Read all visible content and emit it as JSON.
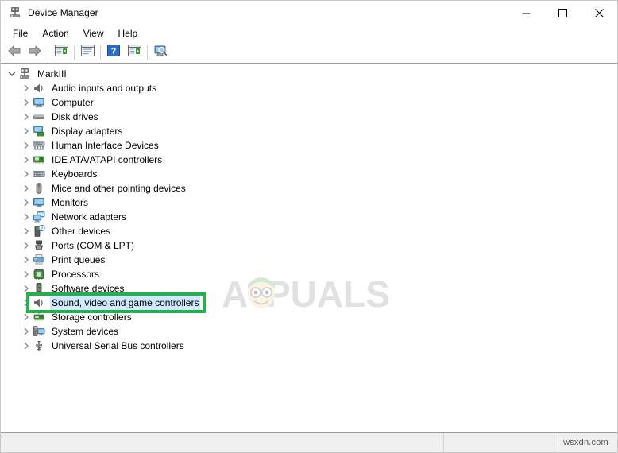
{
  "window": {
    "title": "Device Manager",
    "title_icon": "device-manager-icon",
    "controls": [
      {
        "name": "minimize-button",
        "glyph": "minimize"
      },
      {
        "name": "maximize-button",
        "glyph": "maximize"
      },
      {
        "name": "close-button",
        "glyph": "close"
      }
    ]
  },
  "menubar": {
    "items": [
      {
        "label": "File"
      },
      {
        "label": "Action"
      },
      {
        "label": "View"
      },
      {
        "label": "Help"
      }
    ]
  },
  "toolbar": {
    "buttons": [
      {
        "name": "back-button",
        "icon": "back-arrow-icon"
      },
      {
        "name": "forward-button",
        "icon": "forward-arrow-icon"
      },
      {
        "name": "show-hide-console-tree-button",
        "icon": "console-tree-icon"
      },
      {
        "name": "properties-button",
        "icon": "properties-window-icon"
      },
      {
        "name": "help-button",
        "icon": "help-question-icon"
      },
      {
        "name": "update-driver-button",
        "icon": "update-driver-icon"
      },
      {
        "name": "scan-hardware-changes-button",
        "icon": "scan-monitor-icon"
      }
    ]
  },
  "tree": {
    "root": {
      "label": "MarkIII",
      "icon": "computer-root-icon",
      "expanded": true
    },
    "items": [
      {
        "label": "Audio inputs and outputs",
        "icon": "speaker-icon",
        "selected": false
      },
      {
        "label": "Computer",
        "icon": "monitor-icon",
        "selected": false
      },
      {
        "label": "Disk drives",
        "icon": "disk-drive-icon",
        "selected": false
      },
      {
        "label": "Display adapters",
        "icon": "display-adapter-icon",
        "selected": false
      },
      {
        "label": "Human Interface Devices",
        "icon": "hid-icon",
        "selected": false
      },
      {
        "label": "IDE ATA/ATAPI controllers",
        "icon": "ide-controller-icon",
        "selected": false
      },
      {
        "label": "Keyboards",
        "icon": "keyboard-icon",
        "selected": false
      },
      {
        "label": "Mice and other pointing devices",
        "icon": "mouse-icon",
        "selected": false
      },
      {
        "label": "Monitors",
        "icon": "monitor-icon",
        "selected": false
      },
      {
        "label": "Network adapters",
        "icon": "network-adapter-icon",
        "selected": false
      },
      {
        "label": "Other devices",
        "icon": "other-device-icon",
        "selected": false
      },
      {
        "label": "Ports (COM & LPT)",
        "icon": "port-icon",
        "selected": false
      },
      {
        "label": "Print queues",
        "icon": "printer-icon",
        "selected": false
      },
      {
        "label": "Processors",
        "icon": "processor-icon",
        "selected": false
      },
      {
        "label": "Software devices",
        "icon": "software-device-icon",
        "selected": false
      },
      {
        "label": "Sound, video and game controllers",
        "icon": "speaker-icon",
        "selected": true
      },
      {
        "label": "Storage controllers",
        "icon": "storage-controller-icon",
        "selected": false
      },
      {
        "label": "System devices",
        "icon": "system-device-icon",
        "selected": false
      },
      {
        "label": "Universal Serial Bus controllers",
        "icon": "usb-icon",
        "selected": false
      }
    ],
    "collapsed_chevron": "chevron-right-icon",
    "expanded_chevron": "chevron-down-icon"
  },
  "annotation": {
    "color": "#22b14c",
    "target_label": "Sound, video and game controllers"
  },
  "watermark": {
    "text": "APPUALS",
    "color": "#9e9e9e"
  },
  "statusbar": {
    "main_text": "",
    "mid_text": "",
    "right_text": "wsxdn.com"
  }
}
